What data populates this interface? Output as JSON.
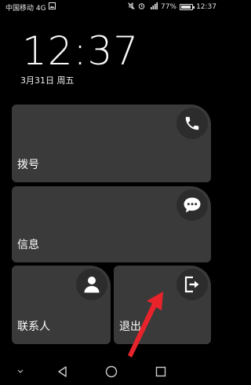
{
  "status_bar": {
    "carrier": "中国移动 4G",
    "battery_text": "77%",
    "time": "12:37"
  },
  "lock": {
    "clock": "12:37",
    "date": "3月31日 周五"
  },
  "tiles": [
    {
      "label": "拨号",
      "icon": "phone-icon"
    },
    {
      "label": "信息",
      "icon": "chat-bubble-icon"
    },
    {
      "label": "联系人",
      "icon": "person-icon"
    },
    {
      "label": "退出",
      "icon": "exit-icon"
    }
  ],
  "nav": {
    "items": [
      "chevron-down-icon",
      "back-icon",
      "home-icon",
      "recents-icon"
    ]
  },
  "colors": {
    "tile": "#3a3a3a",
    "icon_circle": "#2c2c2c",
    "annotation_arrow": "#e8232b"
  }
}
